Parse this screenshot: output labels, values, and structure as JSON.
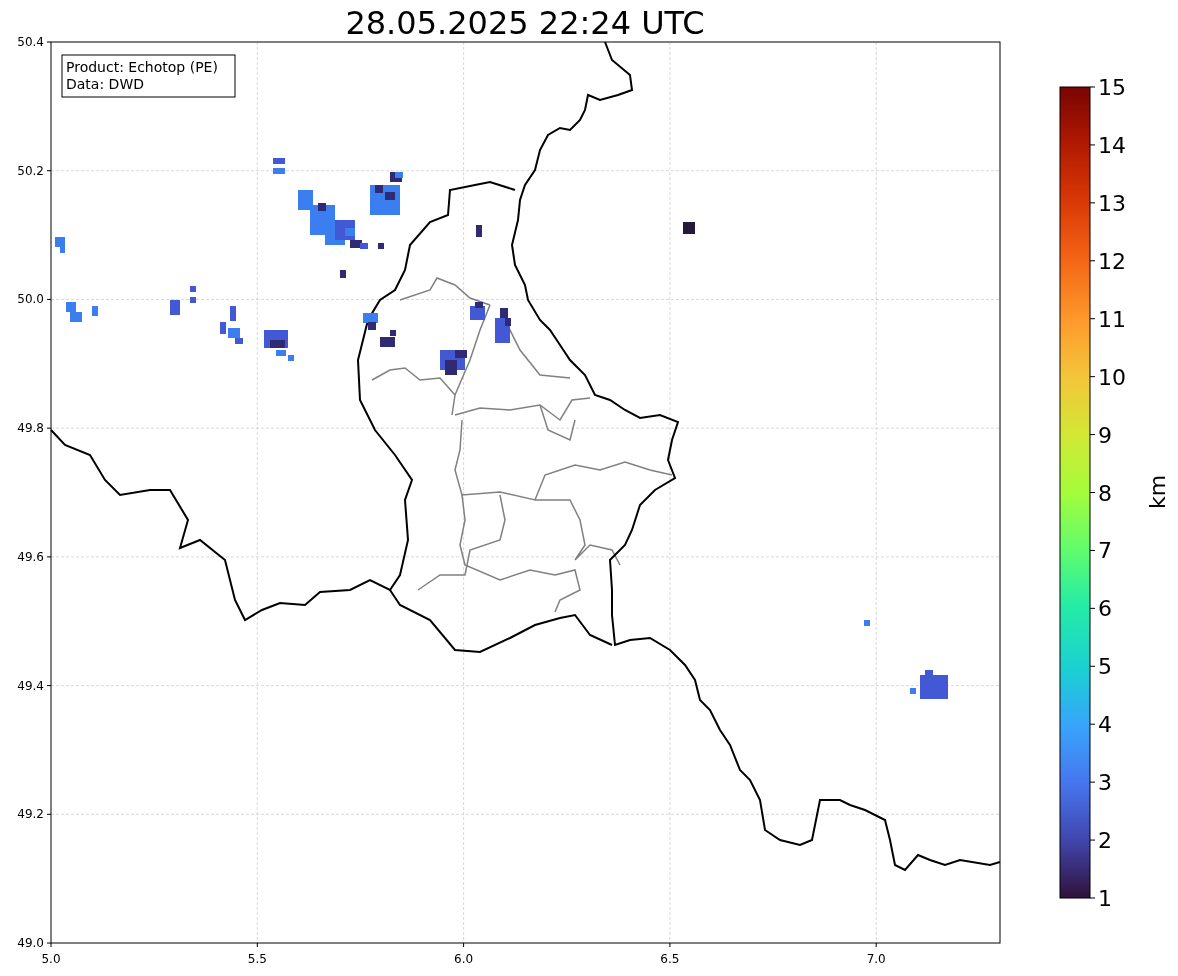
{
  "title": "28.05.2025 22:24 UTC",
  "info_box": {
    "lines": [
      "Product: Echotop (PE)",
      "Data: DWD"
    ]
  },
  "x_ticks": [
    "5.0",
    "5.5",
    "6.0",
    "6.5",
    "7.0"
  ],
  "y_ticks": [
    "50.4",
    "50.2",
    "50.0",
    "49.8",
    "49.6",
    "49.4",
    "49.2",
    "49.0"
  ],
  "colorbar": {
    "label": "km",
    "ticks": [
      "15",
      "14",
      "13",
      "12",
      "11",
      "10",
      "9",
      "8",
      "7",
      "6",
      "5",
      "4",
      "3",
      "2",
      "1"
    ]
  }
}
